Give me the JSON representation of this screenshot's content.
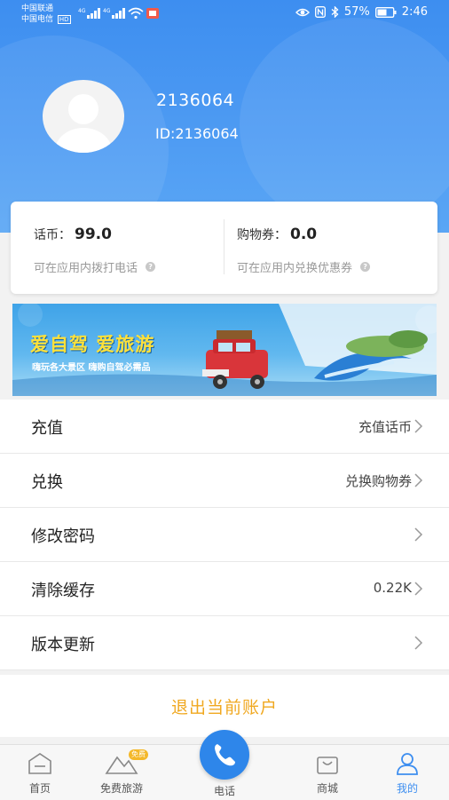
{
  "status_bar": {
    "carrier_1": "中国联通",
    "carrier_2": "中国电信",
    "network_1": "4G",
    "network_2": "4G",
    "hd_badge": "HD",
    "battery": "57%",
    "time": "2:46"
  },
  "profile": {
    "username": "2136064",
    "user_id": "ID:2136064"
  },
  "balance": {
    "coins_label": "话币：",
    "coins_value": "99.0",
    "coins_hint": "可在应用内拨打电话",
    "vouchers_label": "购物券：",
    "vouchers_value": "0.0",
    "vouchers_hint": "可在应用内兑换优惠券"
  },
  "banner": {
    "title": "爱自驾 爱旅游",
    "subtitle": "嗨玩各大景区 嗨购自驾必需品"
  },
  "menu": [
    {
      "label": "充值",
      "value": "充值话币"
    },
    {
      "label": "兑换",
      "value": "兑换购物券"
    },
    {
      "label": "修改密码",
      "value": ""
    },
    {
      "label": "清除缓存",
      "value": "0.22K"
    },
    {
      "label": "版本更新",
      "value": ""
    }
  ],
  "logout_label": "退出当前账户",
  "nav": {
    "home": "首页",
    "travel": "免费旅游",
    "travel_badge": "免费",
    "phone": "电话",
    "mall": "商城",
    "mine": "我的"
  },
  "colors": {
    "header": "#3d8ef0",
    "accent": "#3d8ef0",
    "logout": "#f0a820"
  }
}
